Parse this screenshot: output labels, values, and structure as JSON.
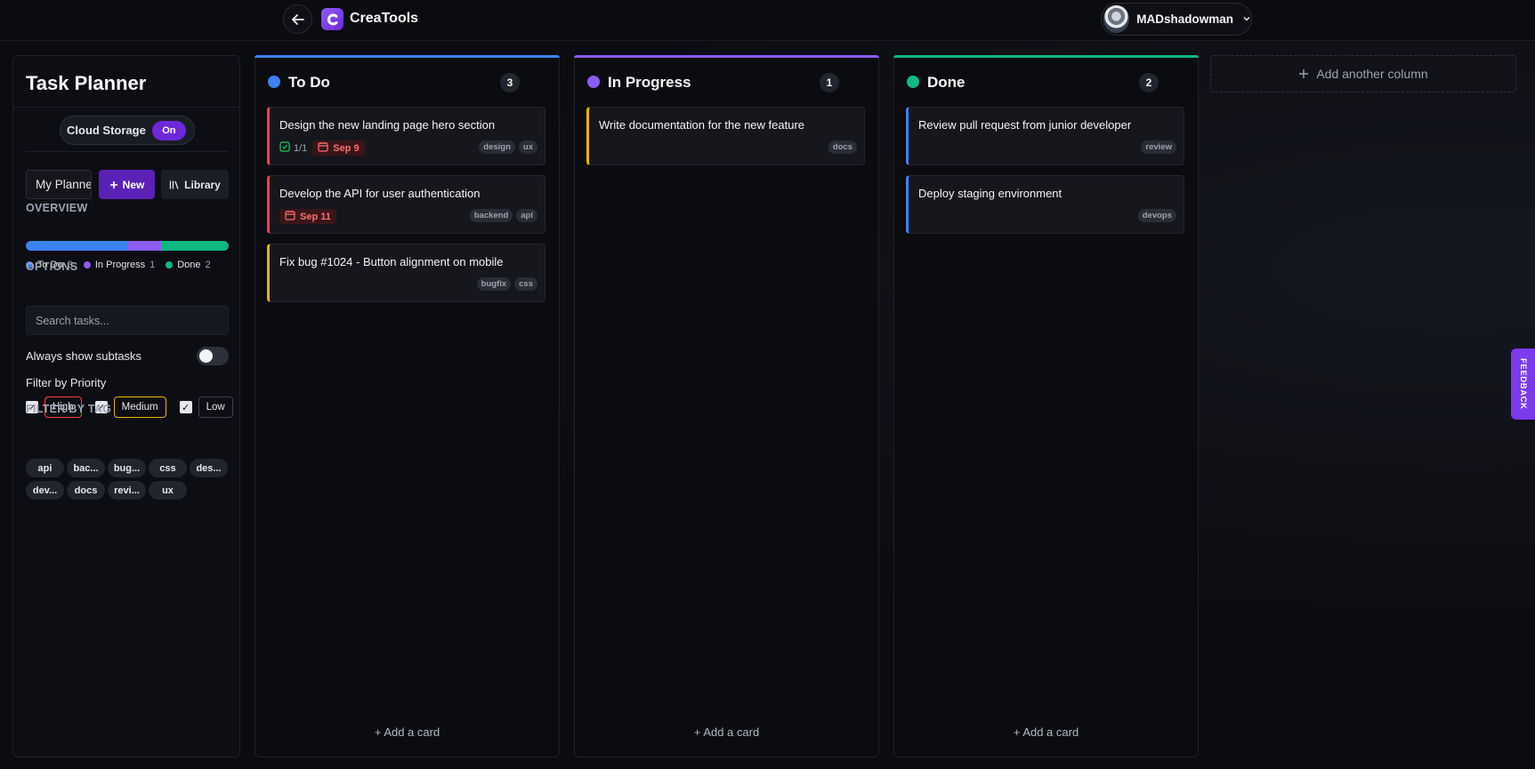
{
  "topbar": {
    "back_icon": "arrow-left-icon",
    "logo_icon": "creatools-logo-icon",
    "brand": "CreaTools",
    "user": {
      "name": "MADshadowman",
      "menu_icon": "chevron-down-icon"
    }
  },
  "sidebar": {
    "title": "Task Planner",
    "cloud_storage": {
      "label": "Cloud Storage",
      "state": "On"
    },
    "planner_name": "My Planner",
    "new_label": "New",
    "library_label": "Library",
    "overview": {
      "heading": "OVERVIEW",
      "segments": [
        {
          "label": "To Do",
          "count": "3",
          "color": "#3b82f6"
        },
        {
          "label": "In Progress",
          "count": "1",
          "color": "#8b5cf6"
        },
        {
          "label": "Done",
          "count": "2",
          "color": "#10b981"
        }
      ]
    },
    "options": {
      "heading": "OPTIONS",
      "search_placeholder": "Search tasks...",
      "always_show_subtasks": "Always show subtasks",
      "always_show_subtasks_on": false,
      "filter_priority_label": "Filter by Priority",
      "priorities": [
        {
          "label": "High",
          "checked": true,
          "color": "#ef4444"
        },
        {
          "label": "Medium",
          "checked": true,
          "color": "#eab308"
        },
        {
          "label": "Low",
          "checked": true,
          "color": "#3f4350"
        }
      ]
    },
    "tag_filter": {
      "heading": "FILTER BY TAG",
      "tags": [
        "api",
        "bac...",
        "bug...",
        "css",
        "des...",
        "dev...",
        "docs",
        "revi...",
        "ux"
      ]
    }
  },
  "columns": [
    {
      "title": "To Do",
      "count": "3",
      "color": "#3b82f6",
      "add_card": "Add a card",
      "cards": [
        {
          "title": "Design the new landing page hero section",
          "subtasks": "1/1",
          "due": "Sep 9",
          "priority_color": "#ef4444",
          "tags": [
            "design",
            "ux"
          ]
        },
        {
          "title": "Develop the API for user authentication",
          "subtasks": "",
          "due": "Sep 11",
          "priority_color": "#ef4444",
          "tags": [
            "backend",
            "api"
          ]
        },
        {
          "title": "Fix bug #1024 - Button alignment on mobile",
          "subtasks": "",
          "due": "",
          "priority_color": "#eab308",
          "tags": [
            "bugfix",
            "css"
          ]
        }
      ]
    },
    {
      "title": "In Progress",
      "count": "1",
      "color": "#8b5cf6",
      "add_card": "Add a card",
      "cards": [
        {
          "title": "Write documentation for the new feature",
          "subtasks": "",
          "due": "",
          "priority_color": "#eab308",
          "tags": [
            "docs"
          ]
        }
      ]
    },
    {
      "title": "Done",
      "count": "2",
      "color": "#10b981",
      "add_card": "Add a card",
      "cards": [
        {
          "title": "Review pull request from junior developer",
          "subtasks": "",
          "due": "",
          "priority_color": "#3b82f6",
          "tags": [
            "review"
          ]
        },
        {
          "title": "Deploy staging environment",
          "subtasks": "",
          "due": "",
          "priority_color": "#3b82f6",
          "tags": [
            "devops"
          ]
        }
      ]
    }
  ],
  "add_column": "Add another column",
  "feedback": "FEEDBACK"
}
